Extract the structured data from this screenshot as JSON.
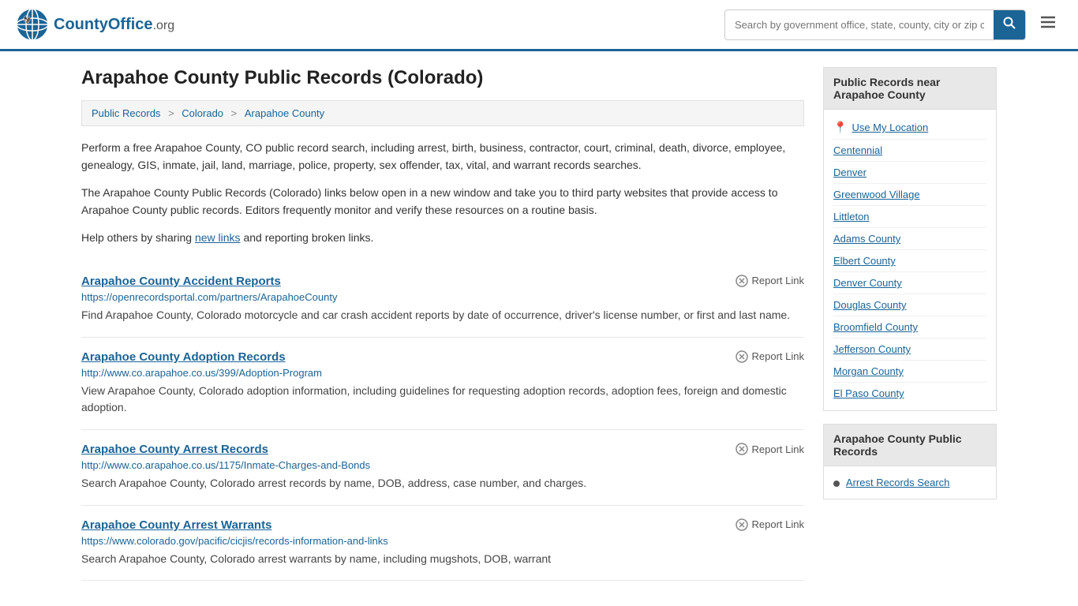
{
  "header": {
    "logo_text": "CountyOffice",
    "logo_suffix": ".org",
    "search_placeholder": "Search by government office, state, county, city or zip code",
    "search_button_label": "🔍"
  },
  "page": {
    "title": "Arapahoe County Public Records (Colorado)"
  },
  "breadcrumb": {
    "items": [
      {
        "label": "Public Records",
        "href": "#"
      },
      {
        "label": "Colorado",
        "href": "#"
      },
      {
        "label": "Arapahoe County",
        "href": "#"
      }
    ]
  },
  "intro": {
    "text1": "Perform a free Arapahoe County, CO public record search, including arrest, birth, business, contractor, court, criminal, death, divorce, employee, genealogy, GIS, inmate, jail, land, marriage, police, property, sex offender, tax, vital, and warrant records searches.",
    "text2": "The Arapahoe County Public Records (Colorado) links below open in a new window and take you to third party websites that provide access to Arapahoe County public records. Editors frequently monitor and verify these resources on a routine basis.",
    "help_text": "Help others by sharing ",
    "new_links_label": "new links",
    "help_text2": " and reporting broken links."
  },
  "records": [
    {
      "title": "Arapahoe County Accident Reports",
      "url": "https://openrecordsportal.com/partners/ArapahoeCounty",
      "desc": "Find Arapahoe County, Colorado motorcycle and car crash accident reports by date of occurrence, driver's license number, or first and last name.",
      "report_label": "Report Link"
    },
    {
      "title": "Arapahoe County Adoption Records",
      "url": "http://www.co.arapahoe.co.us/399/Adoption-Program",
      "desc": "View Arapahoe County, Colorado adoption information, including guidelines for requesting adoption records, adoption fees, foreign and domestic adoption.",
      "report_label": "Report Link"
    },
    {
      "title": "Arapahoe County Arrest Records",
      "url": "http://www.co.arapahoe.co.us/1175/Inmate-Charges-and-Bonds",
      "desc": "Search Arapahoe County, Colorado arrest records by name, DOB, address, case number, and charges.",
      "report_label": "Report Link"
    },
    {
      "title": "Arapahoe County Arrest Warrants",
      "url": "https://www.colorado.gov/pacific/cicjis/records-information-and-links",
      "desc": "Search Arapahoe County, Colorado arrest warrants by name, including mugshots, DOB, warrant",
      "report_label": "Report Link"
    }
  ],
  "sidebar": {
    "nearby_section": {
      "title": "Public Records near Arapahoe County",
      "use_my_location": "Use My Location",
      "locations": [
        "Centennial",
        "Denver",
        "Greenwood Village",
        "Littleton",
        "Adams County",
        "Elbert County",
        "Denver County",
        "Douglas County",
        "Broomfield County",
        "Jefferson County",
        "Morgan County",
        "El Paso County"
      ]
    },
    "records_section": {
      "title": "Arapahoe County Public Records",
      "links": [
        "Arrest Records Search"
      ]
    }
  }
}
